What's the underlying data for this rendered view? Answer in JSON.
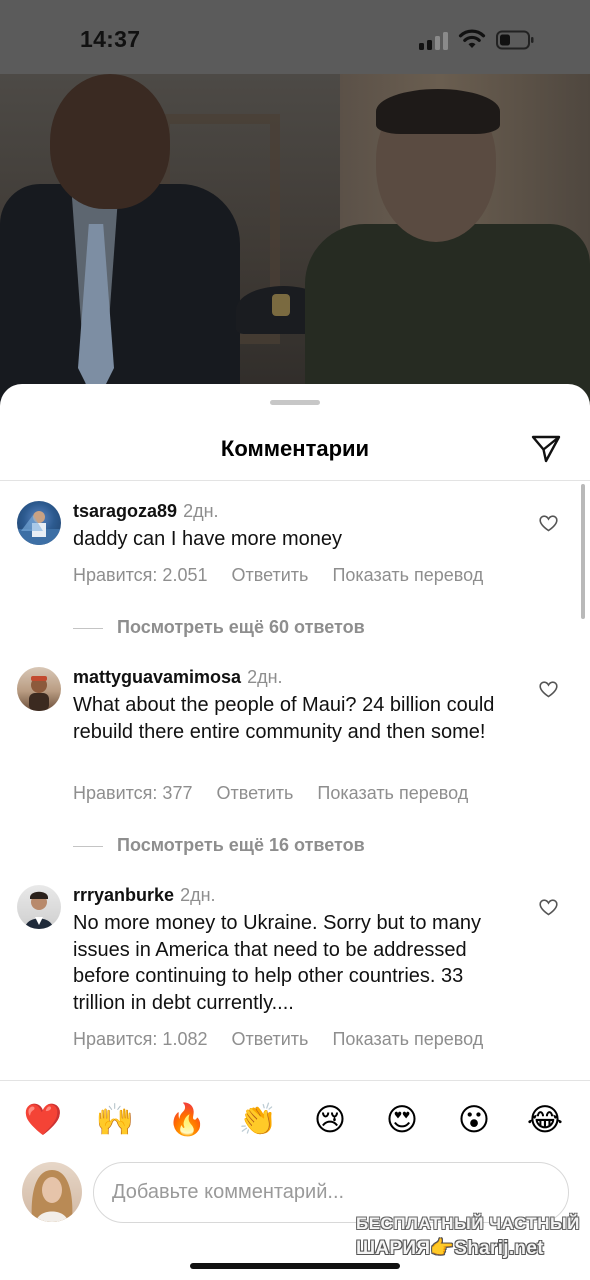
{
  "status_bar": {
    "time": "14:37"
  },
  "sheet": {
    "title": "Комментарии",
    "share_icon": "paper-plane-icon"
  },
  "comments": [
    {
      "username": "tsaragoza89",
      "time": "2дн.",
      "text": "daddy can I have more money",
      "likes": "Нравится: 2.051",
      "reply": "Ответить",
      "translate": "Показать перевод",
      "view_replies": "Посмотреть ещё 60 ответов"
    },
    {
      "username": "mattyguavamimosa",
      "time": "2дн.",
      "text": "What about the people of Maui? 24 billion could rebuild there entire community and then some!",
      "likes": "Нравится: 377",
      "reply": "Ответить",
      "translate": "Показать перевод",
      "view_replies": "Посмотреть ещё 16 ответов"
    },
    {
      "username": "rrryanburke",
      "time": "2дн.",
      "text": "No more money to Ukraine. Sorry but to many issues in America that need to be addressed before continuing to help other countries. 33 trillion in debt currently....",
      "likes": "Нравится: 1.082",
      "reply": "Ответить",
      "translate": "Показать перевод"
    }
  ],
  "emoji_reactions": [
    "❤️",
    "🙌",
    "🔥",
    "👏",
    "😢",
    "😍",
    "😮",
    "😂"
  ],
  "composer": {
    "placeholder": "Добавьте комментарий..."
  },
  "watermark": {
    "line1": "БЕСПЛАТНЫЙ ЧАСТНЫЙ",
    "line2": "ШАРИЯ👉Sharij.net"
  },
  "colors": {
    "secondary_text": "#8e8e8e",
    "divider": "#e3e3e3"
  }
}
